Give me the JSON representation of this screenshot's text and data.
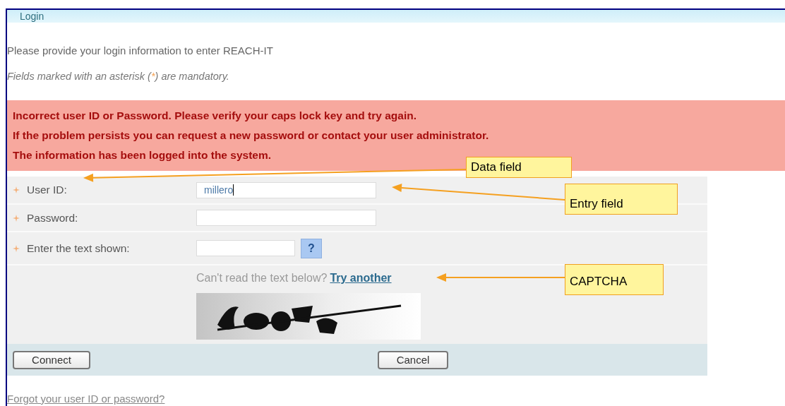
{
  "header": {
    "title": "Login"
  },
  "intro": "Please provide your login information to enter REACH-IT",
  "mandatory_note": {
    "before": "Fields marked with an asterisk (",
    "mark": "*",
    "after": ") are mandatory."
  },
  "error": {
    "lines": [
      "Incorrect user ID or Password. Please verify your caps lock key and try again.",
      "If the problem persists you can request a new password or contact your user administrator.",
      "The information has been logged into the system."
    ]
  },
  "fields": [
    {
      "kind": "text",
      "label": "User ID:",
      "required": true,
      "value": "millero",
      "focused": true
    },
    {
      "kind": "password",
      "label": "Password:",
      "required": true,
      "focused": false
    },
    {
      "kind": "captcha",
      "label": "Enter the text shown:",
      "required": true,
      "focused": false,
      "help": "?"
    }
  ],
  "captcha": {
    "prompt": "Can't read the text below?",
    "link": "Try another"
  },
  "buttons": [
    {
      "label": "Connect"
    },
    {
      "label": "Cancel"
    }
  ],
  "forgot_link": "Forgot your user ID or password?",
  "callouts": [
    {
      "label": "Data field"
    },
    {
      "label": "Entry field"
    },
    {
      "label": "CAPTCHA"
    }
  ]
}
